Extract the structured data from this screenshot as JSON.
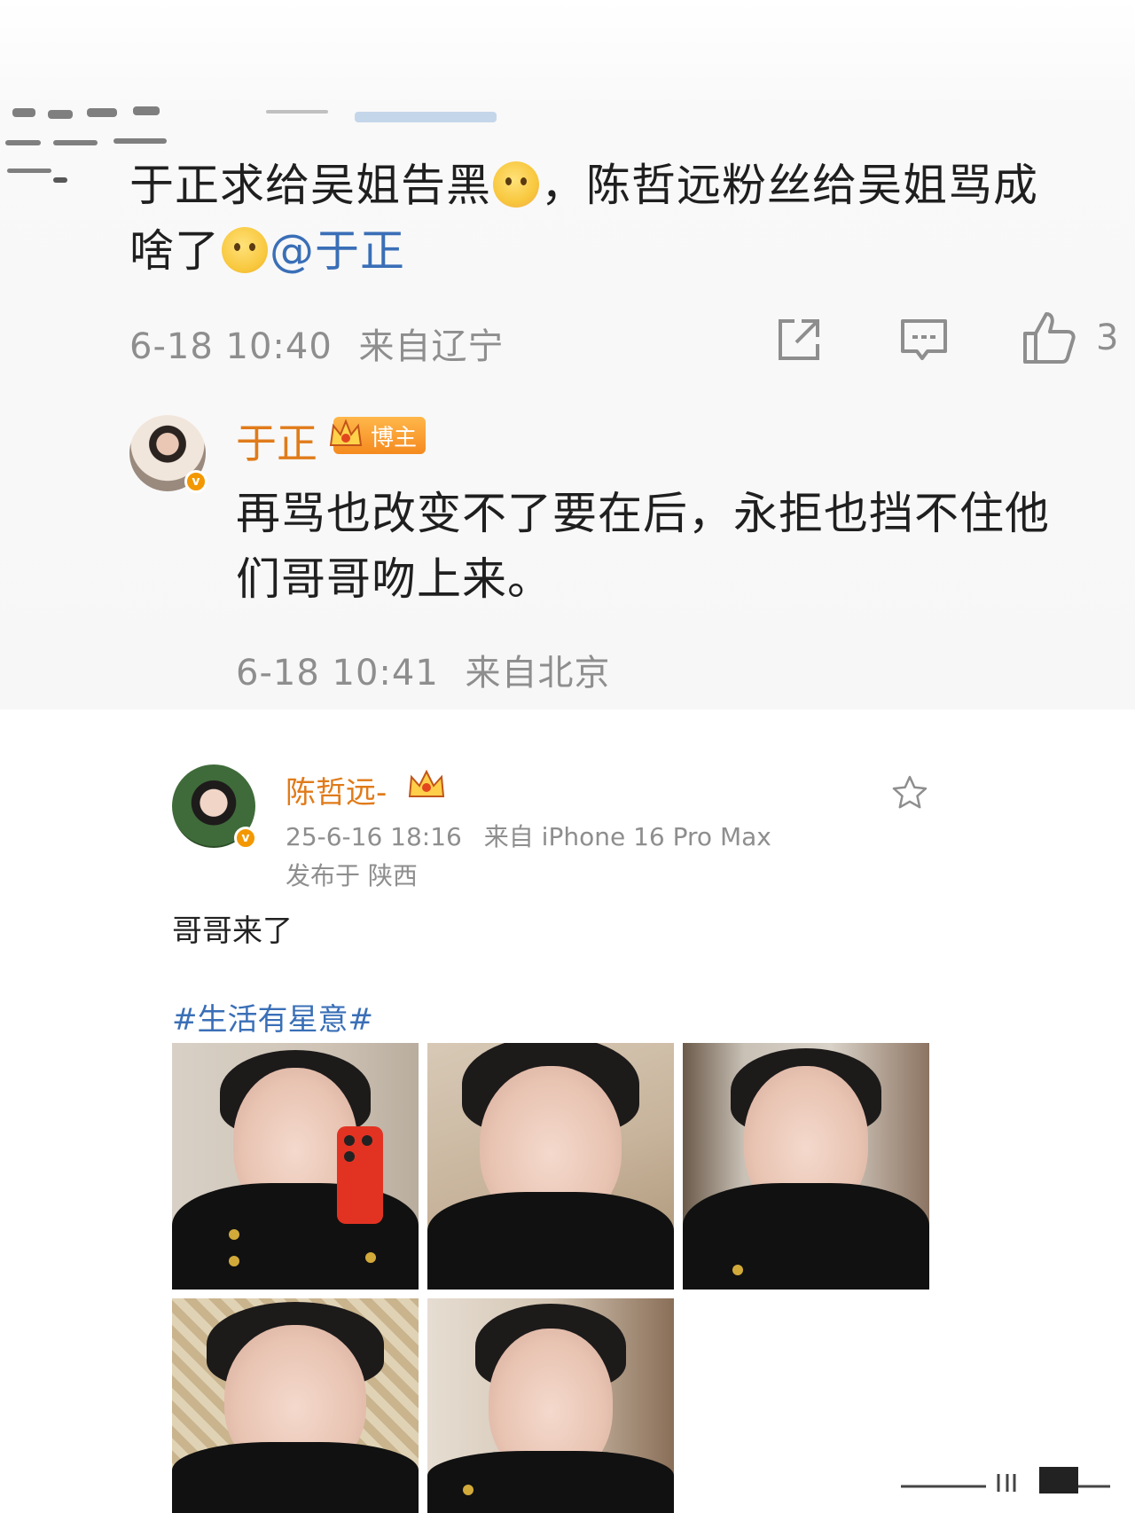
{
  "comment": {
    "text_part1": "于正求给吴姐告黑",
    "text_part2": "，陈哲远粉丝给吴姐骂成啥了",
    "mention": "@于正",
    "emoji_1": "hugging-face-emoji",
    "emoji_2": "thinking-face-emoji",
    "time": "6-18 10:40",
    "location": "来自辽宁",
    "like_count": "3"
  },
  "reply": {
    "author": "于正",
    "badge": "博主",
    "text": "再骂也改变不了要在后，永拒也挡不住他们哥哥吻上来。",
    "time": "6-18 10:41",
    "location": "来自北京"
  },
  "post": {
    "author": "陈哲远-",
    "time": "25-6-16 18:16",
    "source": "来自 iPhone 16 Pro Max",
    "published": "发布于 陕西",
    "body": "哥哥来了",
    "hashtag": "#生活有星意#",
    "photo_count": 5
  },
  "colors": {
    "username": "#e07b1a",
    "link": "#3a6fb7",
    "meta": "#8e8e8e",
    "verified": "#f39800"
  },
  "icons": [
    "share-icon",
    "comment-icon",
    "like-icon",
    "star-icon",
    "verified-icon",
    "crown-icon"
  ]
}
